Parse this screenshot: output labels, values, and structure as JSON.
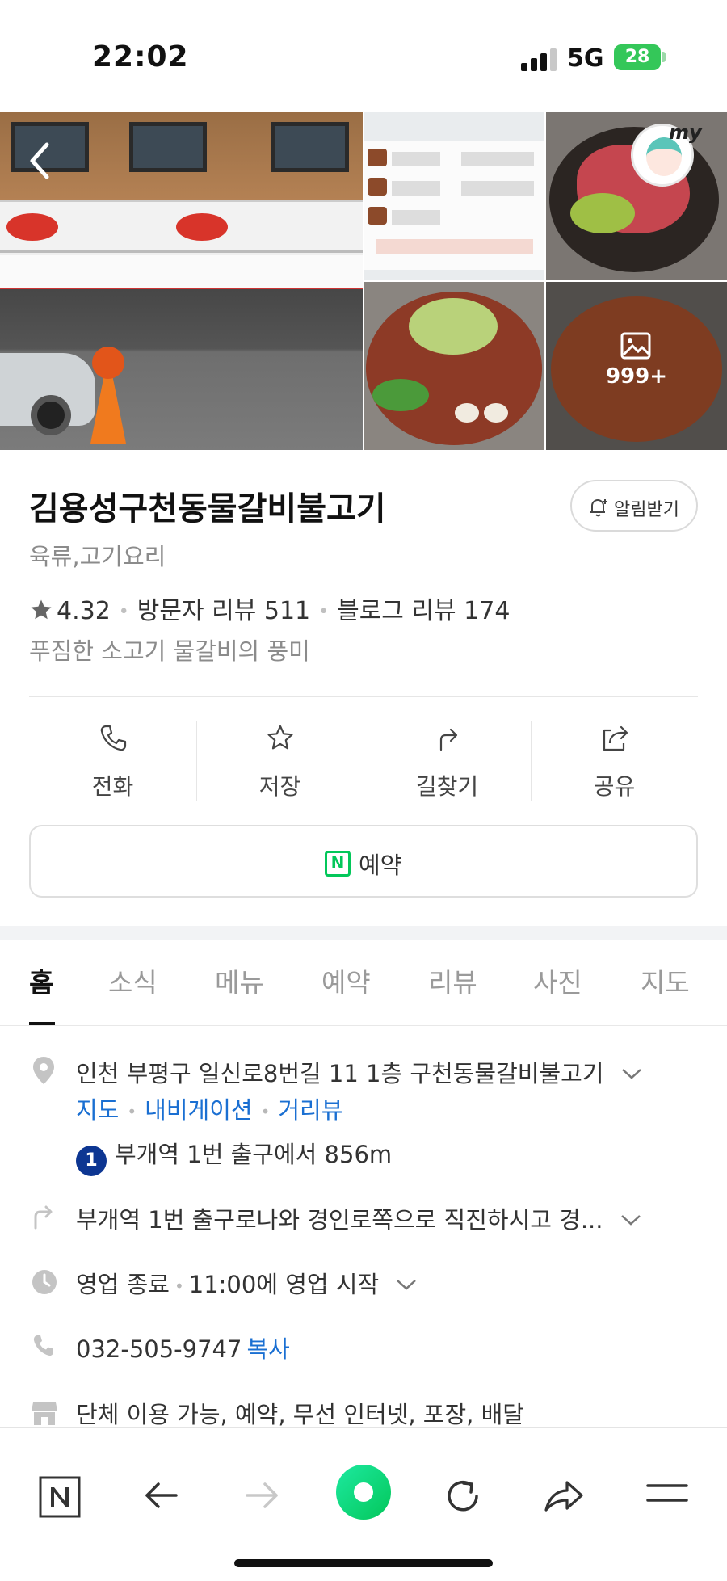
{
  "status": {
    "time": "22:02",
    "network": "5G",
    "battery": "28"
  },
  "photos": {
    "count": "999+",
    "my_badge": "my"
  },
  "place": {
    "title": "김용성구천동물갈비불고기",
    "notify_label": "알림받기",
    "category": "육류,고기요리",
    "rating": "4.32",
    "visitor_reviews": "방문자 리뷰 511",
    "blog_reviews": "블로그 리뷰 174",
    "description": "푸짐한 소고기 물갈비의 풍미"
  },
  "actions": [
    {
      "label": "전화",
      "icon": "phone-icon"
    },
    {
      "label": "저장",
      "icon": "star-icon"
    },
    {
      "label": "길찾기",
      "icon": "directions-icon"
    },
    {
      "label": "공유",
      "icon": "share-icon"
    }
  ],
  "reserve": {
    "label": "예약",
    "icon_text": "N"
  },
  "tabs": [
    "홈",
    "소식",
    "메뉴",
    "예약",
    "리뷰",
    "사진",
    "지도"
  ],
  "info": {
    "address": "인천 부평구 일신로8번길 11 1층 구천동물갈비불고기",
    "links": [
      "지도",
      "내비게이션",
      "거리뷰"
    ],
    "subway_line": "1",
    "subway_text": "부개역 1번 출구에서 856m",
    "directions": "부개역 1번 출구로나와 경인로쪽으로 직진하시고 경...",
    "hours_status": "영업 종료",
    "hours_next": "11:00에 영업 시작",
    "phone": "032-505-9747",
    "copy_label": "복사",
    "amenities": "단체 이용 가능, 예약, 무선 인터넷, 포장, 배달"
  },
  "colors": {
    "naver_green": "#03c75a",
    "link_blue": "#1a6fd2",
    "subway_line1": "#0d3692"
  }
}
